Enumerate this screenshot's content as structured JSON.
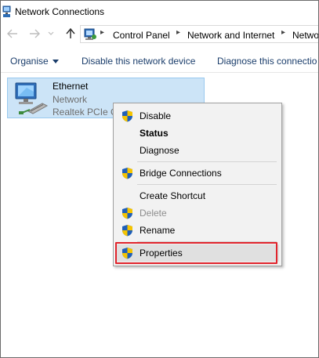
{
  "window": {
    "title": "Network Connections"
  },
  "address": {
    "crumbs": [
      "Control Panel",
      "Network and Internet",
      "Netwo"
    ]
  },
  "toolbar": {
    "organise": "Organise",
    "disable_device": "Disable this network device",
    "diagnose": "Diagnose this connectio"
  },
  "connection": {
    "name": "Ethernet",
    "status": "Network",
    "device": "Realtek PCIe G"
  },
  "context_menu": {
    "items": [
      {
        "label": "Disable",
        "shield": true
      },
      {
        "label": "Status",
        "bold": true
      },
      {
        "label": "Diagnose"
      },
      {
        "label": "Bridge Connections",
        "shield": true
      },
      {
        "label": "Create Shortcut"
      },
      {
        "label": "Delete",
        "shield": true,
        "disabled": true
      },
      {
        "label": "Rename",
        "shield": true
      },
      {
        "label": "Properties",
        "shield": true,
        "highlighted": true
      }
    ]
  },
  "colors": {
    "selection_fill": "#cce4f7",
    "selection_border": "#99c9ef",
    "toolbar_text": "#1a3d6b",
    "annotation_red": "#e0242c"
  }
}
